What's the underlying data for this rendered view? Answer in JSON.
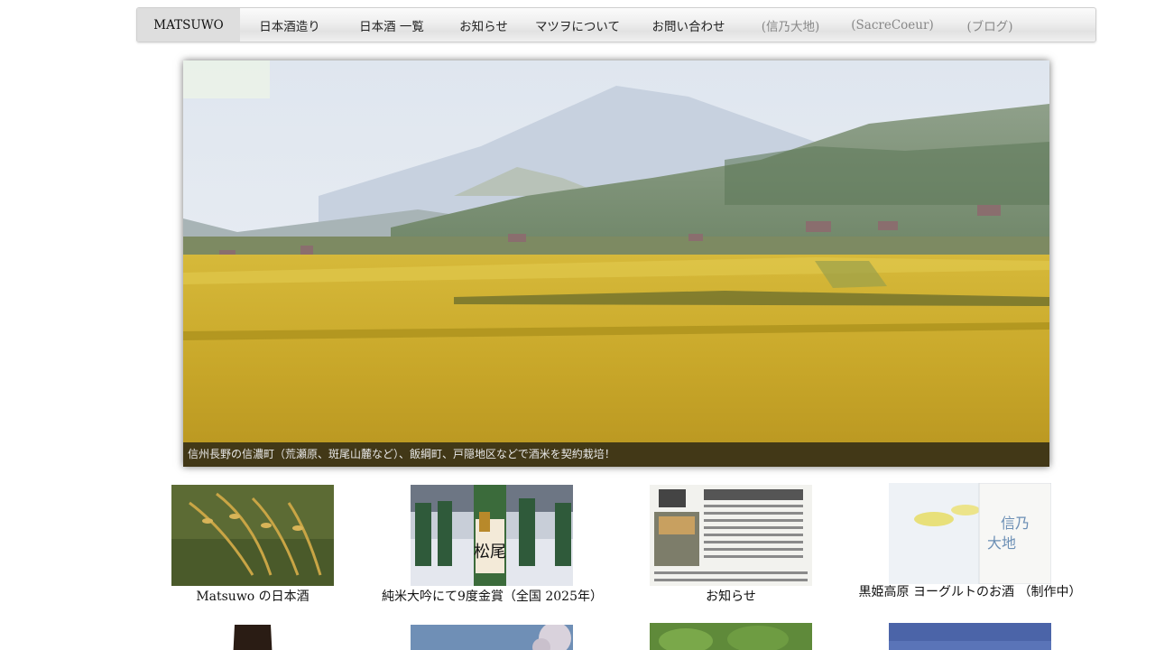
{
  "nav": {
    "items": [
      {
        "label": "MATSUWO",
        "state": "active"
      },
      {
        "label": "日本酒造り",
        "state": "normal"
      },
      {
        "label": "日本酒 一覧",
        "state": "normal"
      },
      {
        "label": "お知らせ",
        "state": "normal"
      },
      {
        "label": "マツヲについて",
        "state": "normal"
      },
      {
        "label": "お問い合わせ",
        "state": "normal"
      },
      {
        "label": "(信乃大地)",
        "state": "muted"
      },
      {
        "label": "(SacreCoeur)",
        "state": "muted"
      },
      {
        "label": "(ブログ)",
        "state": "muted"
      }
    ]
  },
  "hero": {
    "caption": "信州長野の信濃町（荒瀬原、斑尾山麓など）、飯綱町、戸隠地区などで酒米を契約栽培！"
  },
  "tiles": [
    {
      "label": "Matsuwo の日本酒",
      "image": "rice-ears"
    },
    {
      "label": "純米大吟にて9度金賞（全国 2025年）",
      "image": "sake-bottles-award"
    },
    {
      "label": "お知らせ",
      "image": "newspaper-clipping"
    },
    {
      "label": "黒姫高原 ヨーグルトのお酒 （制作中）",
      "image": "yogurt-sake-bottle"
    }
  ],
  "tiles_second_row": [
    {
      "image": "dark-bottle"
    },
    {
      "image": "sky-blossom"
    },
    {
      "image": "green-leaves"
    },
    {
      "image": "blue-sky"
    }
  ],
  "colors": {
    "nav_active_bg": "#dedede",
    "nav_muted_text": "#888888",
    "caption_bg": "#141414"
  }
}
